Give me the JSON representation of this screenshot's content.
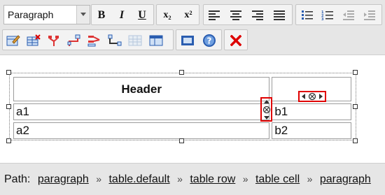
{
  "toolbar": {
    "format_select": {
      "value": "Paragraph"
    },
    "bold_label": "B",
    "italic_label": "I",
    "underline_label": "U",
    "subscript_label": "x₂",
    "superscript_label": "x²",
    "icons": [
      "align-left-icon",
      "align-center-icon",
      "align-right-icon",
      "align-justify-icon",
      "bullet-list-icon",
      "numbered-list-icon",
      "outdent-icon",
      "indent-icon",
      "edit-table-icon",
      "delete-table-icon",
      "delete-row-icon",
      "insert-row-icon",
      "delete-column-icon",
      "insert-column-icon",
      "merge-cells-icon",
      "split-cells-icon",
      "show-blocks-icon",
      "help-icon",
      "close-icon"
    ]
  },
  "table": {
    "header": "Header",
    "rows": [
      [
        "a1",
        "b1"
      ],
      [
        "a2",
        "b2"
      ]
    ]
  },
  "path": {
    "label": "Path:",
    "crumbs": [
      "paragraph",
      "table.default",
      "table row",
      "table cell",
      "paragraph"
    ],
    "separator": "»"
  },
  "colors": {
    "marker": "#e00000",
    "toolbar_bg": "#e6e6e6",
    "accent_blue": "#2a5db0"
  }
}
